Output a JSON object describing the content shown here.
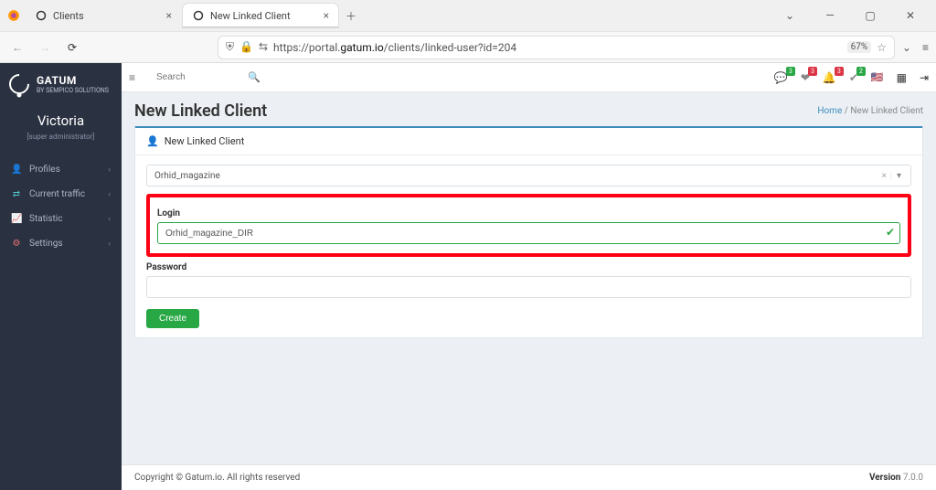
{
  "browser": {
    "tabs": [
      {
        "title": "Clients"
      },
      {
        "title": "New Linked Client"
      }
    ],
    "url_prefix": "https://portal.",
    "url_domain": "gatum.io",
    "url_path": "/clients/linked-user?id=204",
    "zoom": "67%"
  },
  "brand": {
    "name": "GATUM",
    "sub": "BY SEMPICO SOLUTIONS"
  },
  "user": {
    "name": "Victoria",
    "role": "[super administrator]"
  },
  "sidebar": {
    "items": [
      {
        "label": "Profiles"
      },
      {
        "label": "Current traffic"
      },
      {
        "label": "Statistic"
      },
      {
        "label": "Settings"
      }
    ]
  },
  "topbar": {
    "search_placeholder": "Search",
    "badges": [
      "3",
      "3",
      "3",
      "2"
    ]
  },
  "page": {
    "title": "New Linked Client",
    "breadcrumb_home": "Home",
    "breadcrumb_sep": " / ",
    "breadcrumb_current": "New Linked Client"
  },
  "card": {
    "header": "New Linked Client",
    "select_value": "Orhid_magazine",
    "login_label": "Login",
    "login_value": "Orhid_magazine_DIR",
    "password_label": "Password",
    "password_value": "",
    "create_label": "Create"
  },
  "footer": {
    "copyright": "Copyright © Gatum.io. All rights reserved",
    "version_label": "Version",
    "version": " 7.0.0"
  }
}
